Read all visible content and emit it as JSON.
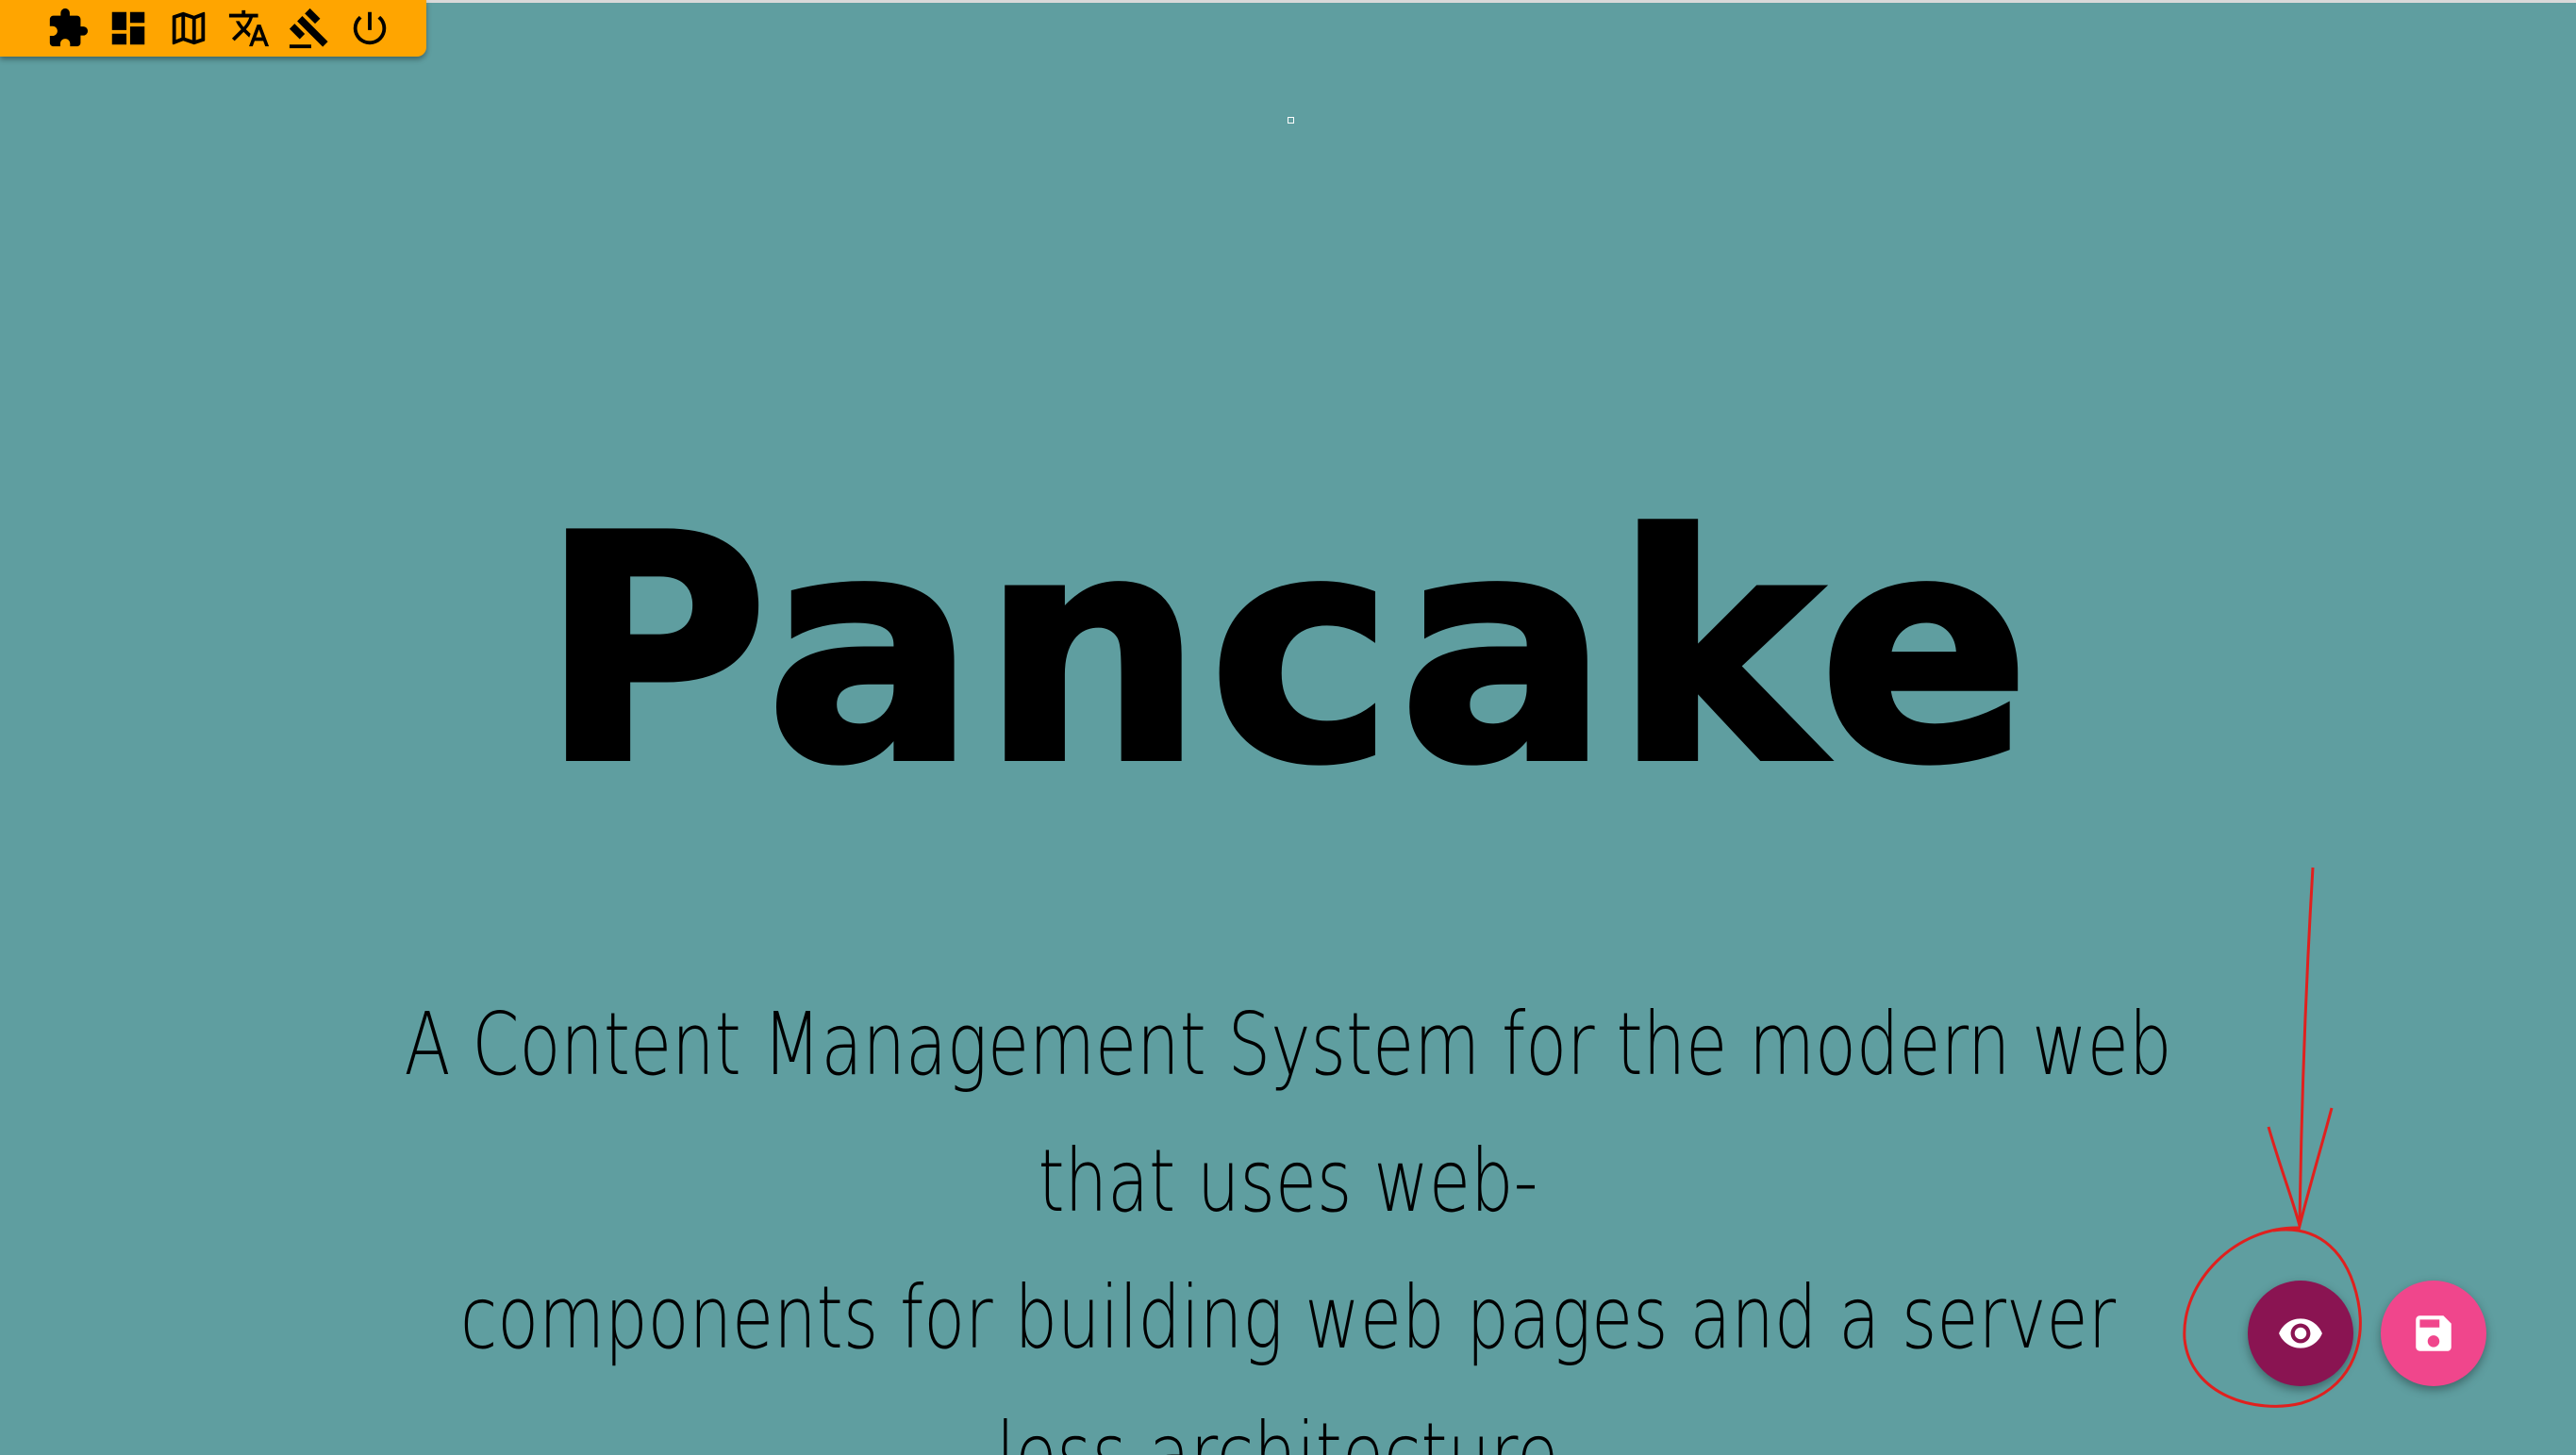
{
  "toolbar": {
    "background": "#ffa500",
    "items": [
      {
        "icon": "puzzle-icon"
      },
      {
        "icon": "dashboard-icon"
      },
      {
        "icon": "map-icon"
      },
      {
        "icon": "translate-icon"
      },
      {
        "icon": "gavel-icon"
      },
      {
        "icon": "power-icon"
      }
    ]
  },
  "hero": {
    "title": "Pancake",
    "subtitle_line1": "A Content Management System for the modern web that uses web-",
    "subtitle_line2": "components for building web pages and a server less architecture."
  },
  "fabs": {
    "preview": {
      "icon": "eye-icon",
      "color": "#8a1452"
    },
    "save": {
      "icon": "save-icon",
      "color": "#f0468c"
    }
  },
  "colors": {
    "page_background": "#5f9ea0",
    "annotation": "#e0201e"
  }
}
